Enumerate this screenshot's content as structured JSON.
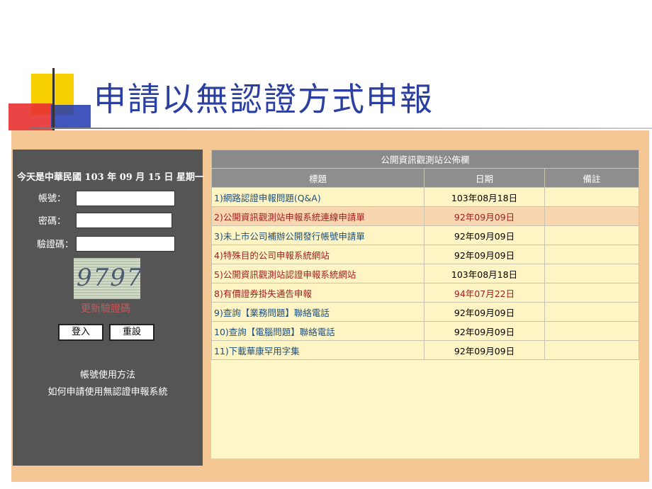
{
  "slide": {
    "title": "申請以無認證方式申報"
  },
  "left_panel": {
    "date": "今天是中華民國 103 年 09 月 15 日 星期一",
    "account_label": "帳號：",
    "password_label": "密碼：",
    "captcha_label": "驗證碼：",
    "account_value": "",
    "password_value": "",
    "captcha_value": "",
    "captcha_text": "9797",
    "refresh_captcha": "更新驗證碼",
    "login_button": "登入",
    "reset_button": "重設",
    "help_link_1": "帳號使用方法",
    "help_link_2": "如何申請使用無認證申報系統"
  },
  "bulletin": {
    "title": "公開資訊觀測站公佈欄",
    "columns": [
      "標題",
      "日期",
      "備註"
    ],
    "rows": [
      {
        "title": "1)網路認證申報問題(Q&A)",
        "date": "103年08月18日",
        "note": ""
      },
      {
        "title": "2)公開資訊觀測站申報系統連線申請單",
        "date": "92年09月09日",
        "note": ""
      },
      {
        "title": "3)未上市公司補辦公開發行帳號申請單",
        "date": "92年09月09日",
        "note": ""
      },
      {
        "title": "4)特殊目的公司申報系統網站",
        "date": "92年09月09日",
        "note": ""
      },
      {
        "title": "5)公開資訊觀測站認證申報系統網站",
        "date": "103年08月18日",
        "note": ""
      },
      {
        "title": "8)有價證券掛失通告申報",
        "date": "94年07月22日",
        "note": ""
      },
      {
        "title": "9)查詢【業務問題】聯絡電話",
        "date": "92年09月09日",
        "note": ""
      },
      {
        "title": "10)查詢【電腦問題】聯絡電話",
        "date": "92年09月09日",
        "note": ""
      },
      {
        "title": "11)下載華康罕用字集",
        "date": "92年09月09日",
        "note": ""
      }
    ]
  }
}
